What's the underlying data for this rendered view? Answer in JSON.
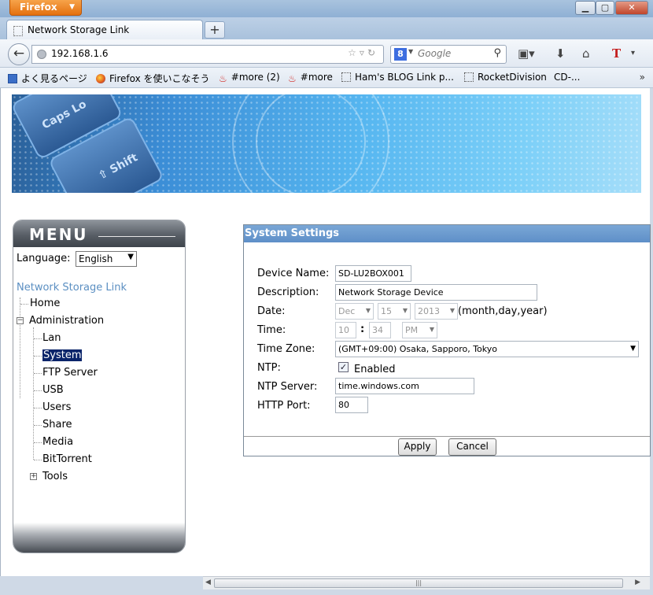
{
  "browser": {
    "app_button": "Firefox",
    "tab_title": "Network Storage Link",
    "new_tab": "+",
    "url": "192.168.1.6",
    "search_placeholder": "Google",
    "search_engine_letter": "8",
    "window_controls": {
      "minimize": "▁",
      "maximize": "▢",
      "close": "✕"
    }
  },
  "bookmarks": [
    "よく見るページ",
    "Firefox を使いこなそう",
    "#more (2)",
    "#more",
    "Ham's BLOG Link p...",
    "RocketDivision",
    "CD-..."
  ],
  "menu": {
    "title": "MENU",
    "language_label": "Language:",
    "language_value": "English",
    "root": "Network Storage Link",
    "home": "Home",
    "administration": "Administration",
    "admin_items": [
      "Lan",
      "System",
      "FTP Server",
      "USB",
      "Users",
      "Share",
      "Media",
      "BitTorrent"
    ],
    "tools": "Tools",
    "selected": "System"
  },
  "settings": {
    "title": "System Settings",
    "device_name_label": "Device Name:",
    "device_name": "SD-LU2BOX001",
    "description_label": "Description:",
    "description": "Network Storage Device",
    "date_label": "Date:",
    "date_month": "Dec",
    "date_day": "15",
    "date_year": "2013",
    "date_hint": "(month,day,year)",
    "time_label": "Time:",
    "time_hour": "10",
    "time_sep": ":",
    "time_min": "34",
    "time_ampm": "PM",
    "timezone_label": "Time Zone:",
    "timezone": "(GMT+09:00) Osaka, Sapporo, Tokyo",
    "ntp_label": "NTP:",
    "ntp_enabled_label": "Enabled",
    "ntp_enabled": true,
    "ntp_server_label": "NTP Server:",
    "ntp_server": "time.windows.com",
    "http_port_label": "HTTP Port:",
    "http_port": "80",
    "apply": "Apply",
    "cancel": "Cancel"
  }
}
